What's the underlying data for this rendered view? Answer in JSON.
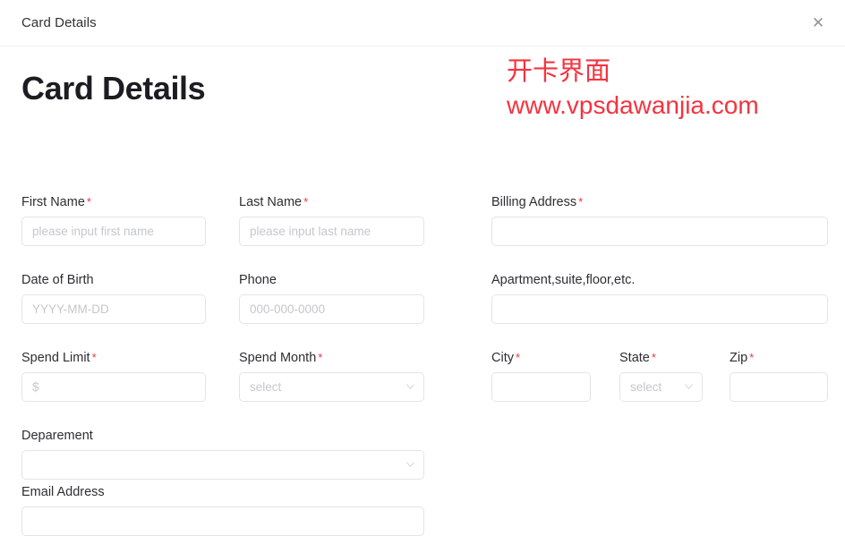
{
  "dialog": {
    "title": "Card Details",
    "close_icon": "close-icon",
    "close_glyph": "✕"
  },
  "heading": "Card Details",
  "watermark": {
    "line1": "开卡界面",
    "line2": "www.vpsdawanjia.com",
    "color": "#f5333f"
  },
  "required_marker": "*",
  "form": {
    "first_name": {
      "label": "First Name",
      "required": true,
      "placeholder": "please input first name",
      "value": ""
    },
    "last_name": {
      "label": "Last Name",
      "required": true,
      "placeholder": "please input last name",
      "value": ""
    },
    "billing_address": {
      "label": "Billing Address",
      "required": true,
      "placeholder": "",
      "value": ""
    },
    "date_of_birth": {
      "label": "Date of Birth",
      "required": false,
      "placeholder": "YYYY-MM-DD",
      "value": ""
    },
    "phone": {
      "label": "Phone",
      "required": false,
      "placeholder": "000-000-0000",
      "value": ""
    },
    "apartment": {
      "label": "Apartment,suite,floor,etc.",
      "required": false,
      "placeholder": "",
      "value": ""
    },
    "spend_limit": {
      "label": "Spend Limit",
      "required": true,
      "placeholder": "$",
      "value": ""
    },
    "spend_month": {
      "label": "Spend Month",
      "required": true,
      "placeholder": "select",
      "value": "",
      "type": "select"
    },
    "city": {
      "label": "City",
      "required": true,
      "placeholder": "",
      "value": ""
    },
    "state": {
      "label": "State",
      "required": true,
      "placeholder": "select",
      "value": "",
      "type": "select"
    },
    "zip": {
      "label": "Zip",
      "required": true,
      "placeholder": "",
      "value": ""
    },
    "deparement": {
      "label": "Deparement",
      "required": false,
      "placeholder": "",
      "value": "",
      "type": "select"
    },
    "email_address": {
      "label": "Email Address",
      "required": false,
      "placeholder": "",
      "value": ""
    }
  }
}
